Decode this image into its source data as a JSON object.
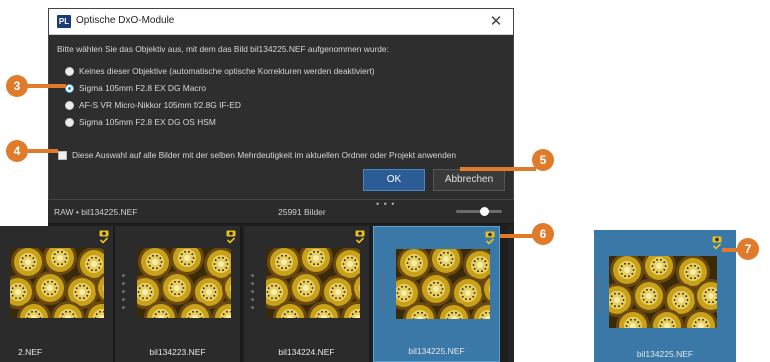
{
  "dialog": {
    "app_logo": "PL",
    "title": "Optische DxO-Module",
    "close_glyph": "✕",
    "prompt": "Bitte wählen Sie das Objektiv aus, mit dem das Bild bil134225.NEF aufgenommen wurde:",
    "options": [
      {
        "label": "Keines dieser Objektive (automatische optische Korrekturen werden deaktiviert)",
        "selected": false
      },
      {
        "label": "Sigma 105mm F2.8 EX DG Macro",
        "selected": true
      },
      {
        "label": "AF-S VR Micro-Nikkor 105mm f/2.8G IF-ED",
        "selected": false
      },
      {
        "label": "Sigma 105mm F2.8 EX DG OS HSM",
        "selected": false
      }
    ],
    "apply_all_label": "Diese Auswahl auf alle Bilder mit der selben Mehrdeutigkeit im aktuellen Ordner oder Projekt anwenden",
    "apply_all_checked": false,
    "ok_label": "OK",
    "cancel_label": "Abbrechen"
  },
  "browser": {
    "path": "RAW • bil134225.NEF",
    "image_count": "25991 Bilder",
    "overflow_glyph": "• • •",
    "thumbnails": [
      {
        "filename": "2.NEF",
        "selected": false
      },
      {
        "filename": "bil134223.NEF",
        "selected": false
      },
      {
        "filename": "bil134224.NEF",
        "selected": false
      },
      {
        "filename": "bil134225.NEF",
        "selected": true
      }
    ]
  },
  "detail": {
    "filename": "bil134225.NEF"
  },
  "callouts": [
    "3",
    "4",
    "5",
    "6",
    "7"
  ],
  "colors": {
    "accent_blue": "#3a78a8",
    "callout_orange": "#e07b2c",
    "dialog_bg": "#2e2e2e",
    "badge_yellow": "#e8c21c"
  }
}
